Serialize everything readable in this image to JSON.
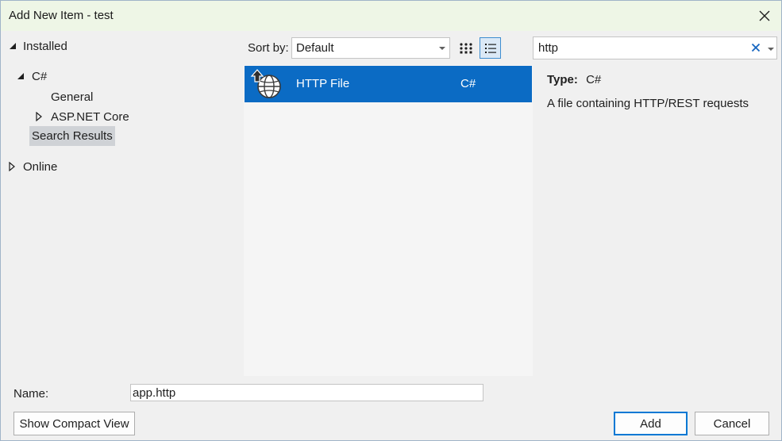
{
  "window": {
    "title": "Add New Item - test"
  },
  "tree": {
    "installed": "Installed",
    "csharp": "C#",
    "general": "General",
    "aspnet": "ASP.NET Core",
    "search_results": "Search Results",
    "online": "Online"
  },
  "toolbar": {
    "sort_label": "Sort by:",
    "sort_value": "Default"
  },
  "search": {
    "value": "http"
  },
  "templates": [
    {
      "name": "HTTP File",
      "language": "C#",
      "icon": "http-file-icon"
    }
  ],
  "details": {
    "type_label": "Type:",
    "type_value": "C#",
    "description": "A file containing HTTP/REST requests"
  },
  "footer": {
    "name_label": "Name:",
    "name_value": "app.http",
    "compact_view_label": "Show Compact View",
    "add_label": "Add",
    "cancel_label": "Cancel"
  },
  "colors": {
    "selection": "#0b6bc4",
    "titlebar": "#eef6e6",
    "accent": "#0078d4"
  }
}
